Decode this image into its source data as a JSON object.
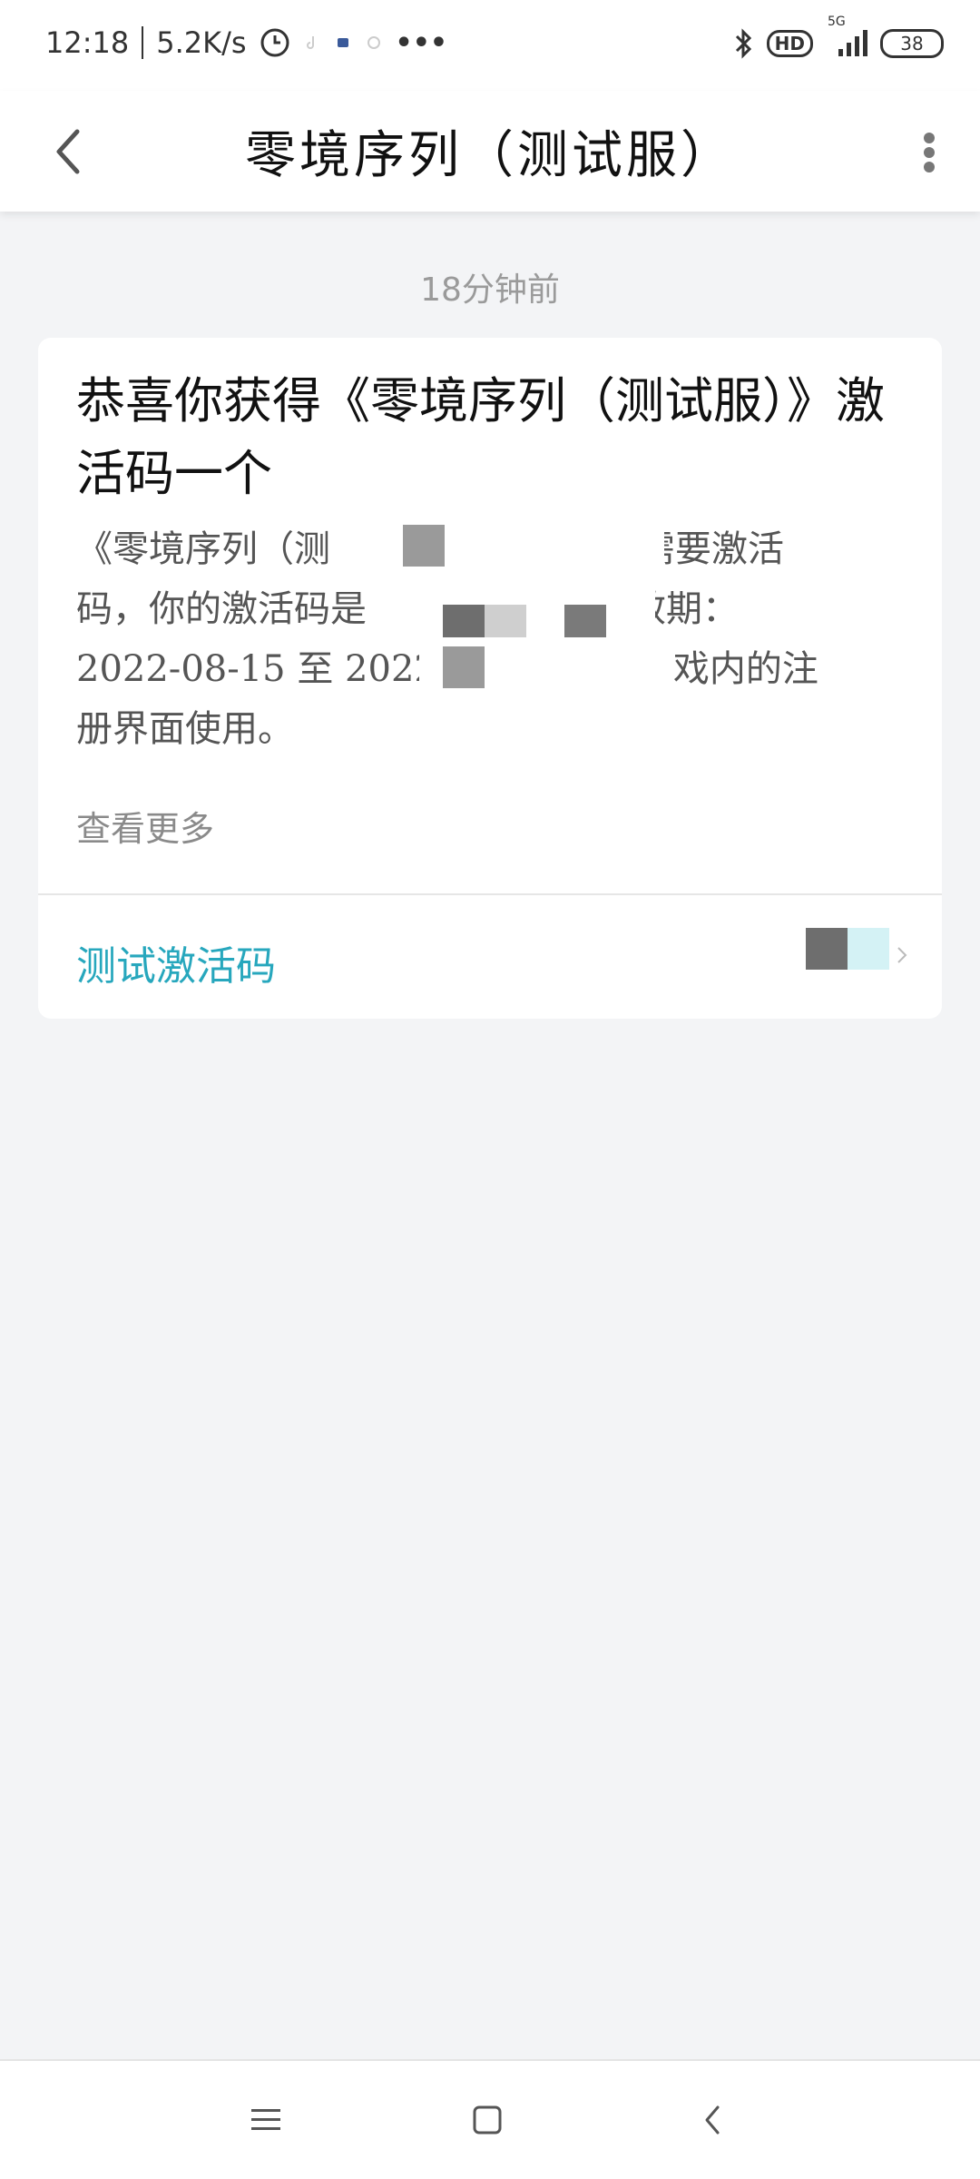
{
  "status_bar": {
    "time": "12:18",
    "speed": "5.2K/s",
    "more": "•••",
    "network": "5G",
    "battery": "38",
    "hd": "HD"
  },
  "header": {
    "title": "零境序列（测试服）"
  },
  "message": {
    "timestamp": "18分钟前",
    "title": "恭喜你获得《零境序列（测试服）》激活码一个",
    "body_line1": "《零境序列（测",
    "body_line1b": "测试需要激活",
    "body_line2": "码，你的激活码是",
    "body_line2b": "有效期：",
    "body_line3": "2022-08-15 至 2022",
    "body_line3b": "游戏内的注",
    "body_line4": "册界面使用。",
    "view_more": "查看更多",
    "footer_label": "测试激活码"
  },
  "colors": {
    "accent": "#27a7bd",
    "background": "#f3f4f6"
  }
}
